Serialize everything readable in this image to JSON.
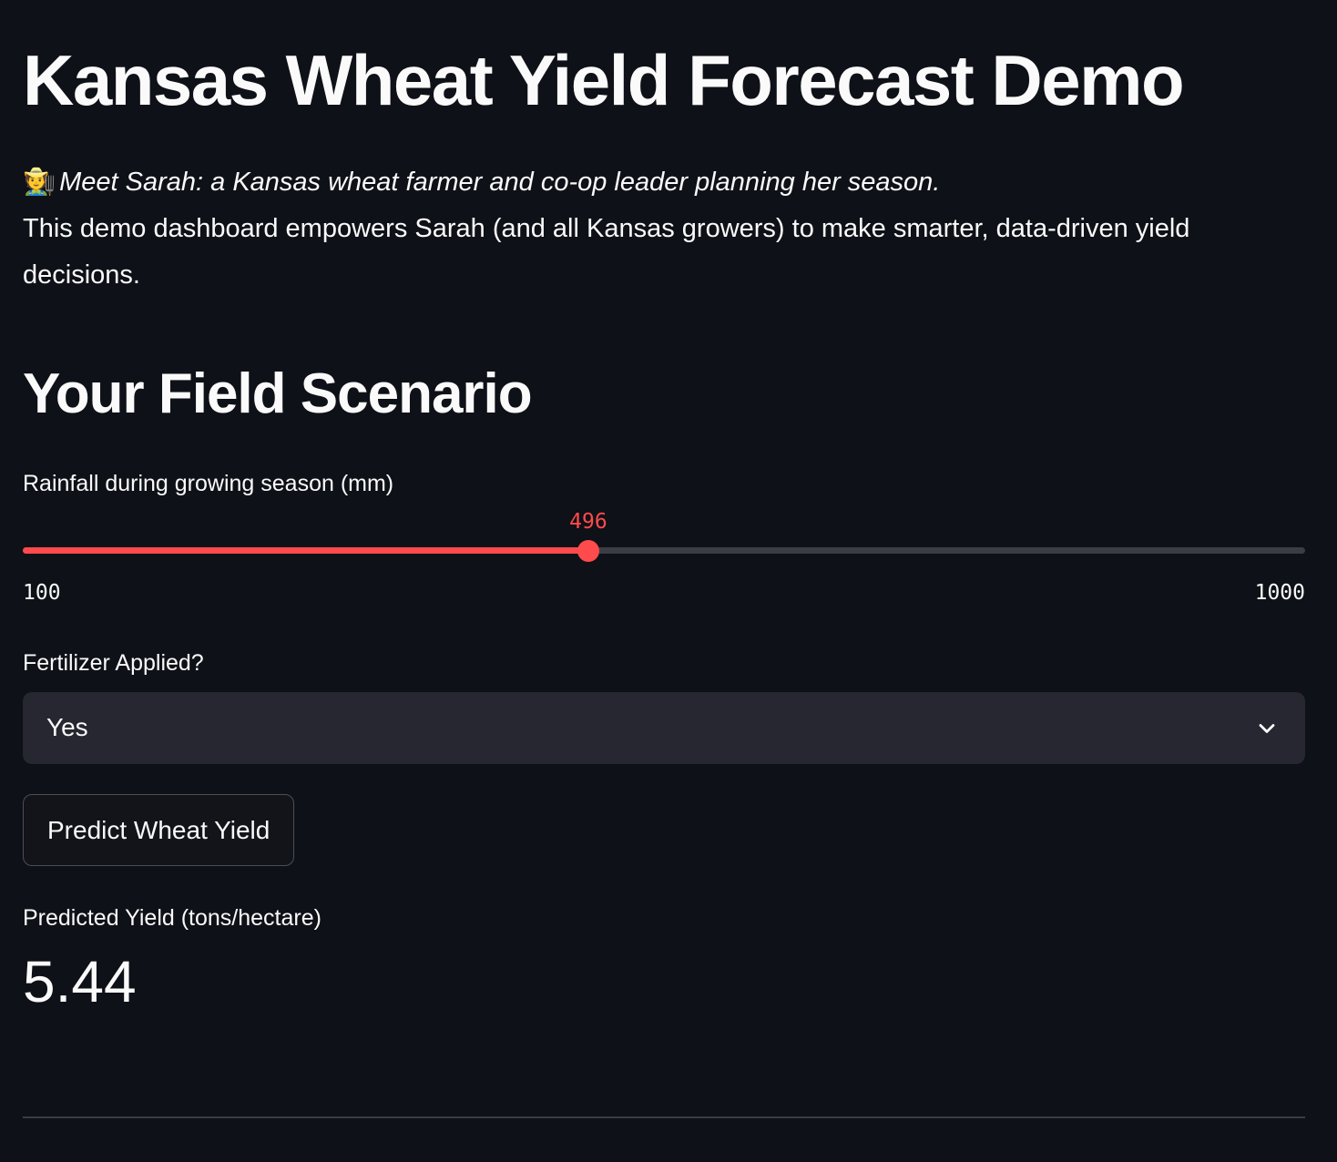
{
  "header": {
    "title": "Kansas Wheat Yield Forecast Demo"
  },
  "intro": {
    "persona_icon": "farmer-emoji",
    "persona_text": "Meet Sarah: a Kansas wheat farmer and co-op leader planning her season.",
    "description": "This demo dashboard empowers Sarah (and all Kansas growers) to make smarter, data-driven yield decisions."
  },
  "scenario": {
    "heading": "Your Field Scenario",
    "rainfall_slider": {
      "label": "Rainfall during growing season (mm)",
      "value": 496,
      "min": 100,
      "max": 1000,
      "accent_color": "#ff4b4b"
    },
    "fertilizer_select": {
      "label": "Fertilizer Applied?",
      "selected": "Yes",
      "icon": "chevron-down-icon"
    },
    "predict_button": {
      "label": "Predict Wheat Yield"
    },
    "result": {
      "label": "Predicted Yield (tons/hectare)",
      "value": "5.44"
    }
  }
}
